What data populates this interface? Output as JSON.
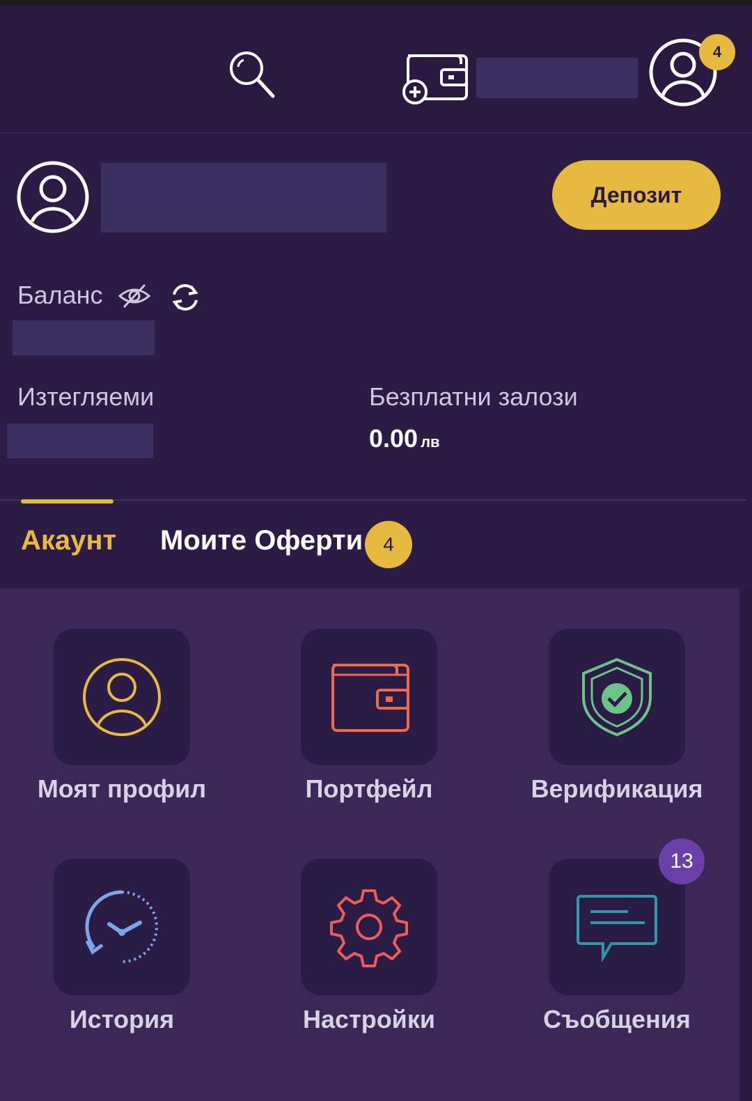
{
  "topbar": {
    "notification_count": "4",
    "icons": [
      "search-icon",
      "wallet-add-icon",
      "user-circle-icon"
    ]
  },
  "account": {
    "deposit_label": "Депозит",
    "balance_label": "Баланс",
    "withdrawable_label": "Изтегляеми",
    "free_bets_label": "Безплатни залози",
    "free_bets_value": "0.00",
    "free_bets_currency": "лв"
  },
  "tabs": {
    "active": "account",
    "account_label": "Акаунт",
    "offers_label": "Моите Оферти",
    "offers_count": "4"
  },
  "menu": {
    "items": [
      {
        "label": "Моят профил",
        "icon": "user-circle-icon",
        "color": "#e6b93f"
      },
      {
        "label": "Портфейл",
        "icon": "wallet-icon",
        "color": "#ee6a4d"
      },
      {
        "label": "Верификация",
        "icon": "shield-check-icon",
        "color": "#6cc38a"
      },
      {
        "label": "История",
        "icon": "history-clock-icon",
        "color": "#7aa7ec"
      },
      {
        "label": "Настройки",
        "icon": "gear-icon",
        "color": "#ee5b5b"
      },
      {
        "label": "Съобщения",
        "icon": "message-icon",
        "color": "#2f98a8"
      }
    ],
    "messages_count": "13"
  },
  "colors": {
    "background": "#2a1a42",
    "panel": "#3b2856",
    "accent": "#e6b93f",
    "badge_purple": "#6b3fa8"
  }
}
